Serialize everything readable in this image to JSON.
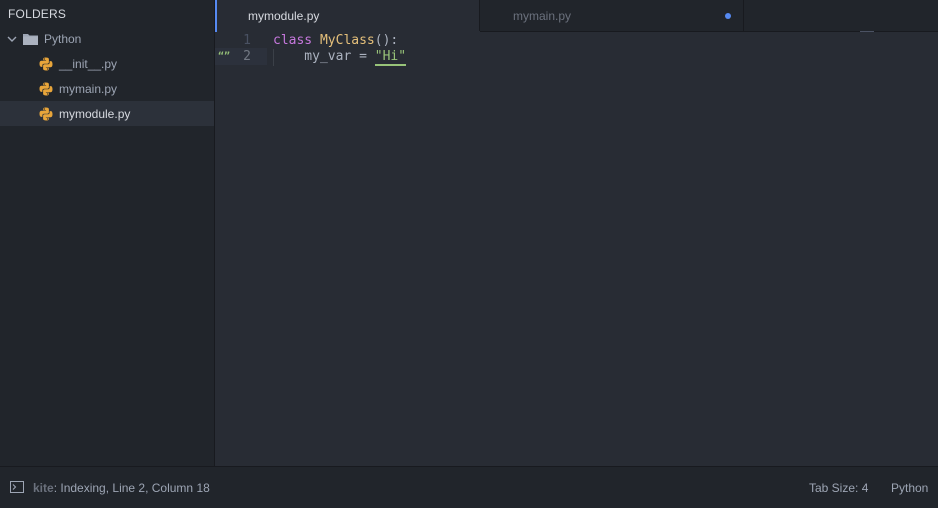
{
  "sidebar": {
    "title": "FOLDERS",
    "folder": {
      "label": "Python",
      "icon": "folder-icon",
      "expanded": true
    },
    "files": [
      {
        "label": "__init__.py",
        "icon": "python-icon",
        "selected": false
      },
      {
        "label": "mymain.py",
        "icon": "python-icon",
        "selected": false
      },
      {
        "label": "mymodule.py",
        "icon": "python-icon",
        "selected": true
      }
    ]
  },
  "tabs": [
    {
      "label": "mymodule.py",
      "active": true,
      "modified": false
    },
    {
      "label": "mymain.py",
      "active": false,
      "modified": true
    }
  ],
  "editor": {
    "line_numbers": [
      "1",
      "2"
    ],
    "current_line": 2,
    "gutter_badge": "“”",
    "lines": [
      {
        "tokens": [
          {
            "text": "class",
            "kind": "keyword"
          },
          {
            "text": " ",
            "kind": "plain"
          },
          {
            "text": "MyClass",
            "kind": "class"
          },
          {
            "text": "():",
            "kind": "punct"
          }
        ]
      },
      {
        "tokens": [
          {
            "text": "    my_var = ",
            "kind": "plain"
          },
          {
            "text": "\"Hi\"",
            "kind": "string"
          }
        ]
      }
    ]
  },
  "statusbar": {
    "kite_label": "kite",
    "status": ": Indexing, Line 2, Column 18",
    "tab_size": "Tab Size: 4",
    "grammar": "Python"
  },
  "colors": {
    "accent": "#568af2",
    "keyword": "#c678dd",
    "class": "#e5c07b",
    "string": "#98c379",
    "python_icon": "#e8a53a"
  }
}
